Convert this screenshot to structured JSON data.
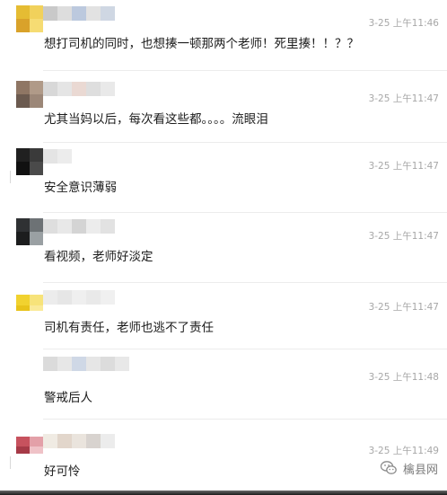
{
  "comments": [
    {
      "text": "想打司机的同时，也想揍一顿那两个老师！死里揍！！？？",
      "time": "3-25 上午11:46",
      "avatar_colors": [
        "#e5bc33",
        "#f1d15b",
        "#d9a22a",
        "#f6dc73"
      ],
      "name_colors": [
        "#c9c9c9",
        "#dddddd",
        "#bcc9de",
        "#e2e2e2",
        "#cfd7e3"
      ]
    },
    {
      "text": "尤其当妈以后，每次看这些都。。。。流眼泪",
      "time": "3-25 上午11:47",
      "avatar_colors": [
        "#8f7664",
        "#b09a88",
        "#6b5a4f",
        "#9c8778"
      ],
      "name_colors": [
        "#d8d8d8",
        "#e5e5e5",
        "#ead9d3",
        "#dedede",
        "#e9e9e9"
      ]
    },
    {
      "text": "安全意识薄弱",
      "time": "3-25 上午11:47",
      "avatar_colors": [
        "#202020",
        "#3a3a3a",
        "#111111",
        "#4a4a4a"
      ],
      "name_colors": [
        "#e4e4e4",
        "#ececec"
      ]
    },
    {
      "text": "看视频，老师好淡定",
      "time": "3-25 上午11:47",
      "avatar_colors": [
        "#2f3133",
        "#6d7275",
        "#1c1d1e",
        "#9aa0a3"
      ],
      "name_colors": [
        "#dedede",
        "#e8e8e8",
        "#d4d4d4",
        "#ececec",
        "#e2e2e2"
      ]
    },
    {
      "text": "司机有责任，老师也逃不了责任",
      "time": "3-25 上午11:47",
      "avatar_colors": [
        "#f1d22f",
        "#f7e37a",
        "#e8c31a",
        "#faea99"
      ],
      "name_colors": [
        "#ececec",
        "#e6e6e6",
        "#efefef",
        "#e9e9e9",
        "#f0f0f0"
      ]
    },
    {
      "text": "警戒后人",
      "time": "3-25 上午11:48",
      "avatar_colors": [
        "#ffffff",
        "#ffffff",
        "#ffffff",
        "#ffffff"
      ],
      "name_colors": [
        "#dbdbdb",
        "#e7e7e7",
        "#cfd8e6",
        "#e6e6e6",
        "#dcdcdc",
        "#e8e8e8"
      ]
    },
    {
      "text": "好可怜",
      "time": "3-25 上午11:49",
      "avatar_colors": [
        "#c7525e",
        "#e3a0a8",
        "#a63a47",
        "#efc2c7"
      ],
      "name_colors": [
        "#f0ebe3",
        "#e2d6cb",
        "#eae4dd",
        "#d8d3cf",
        "#ececec"
      ]
    }
  ],
  "watermark": {
    "label": "檎县网",
    "icon": "wechat-icon"
  }
}
